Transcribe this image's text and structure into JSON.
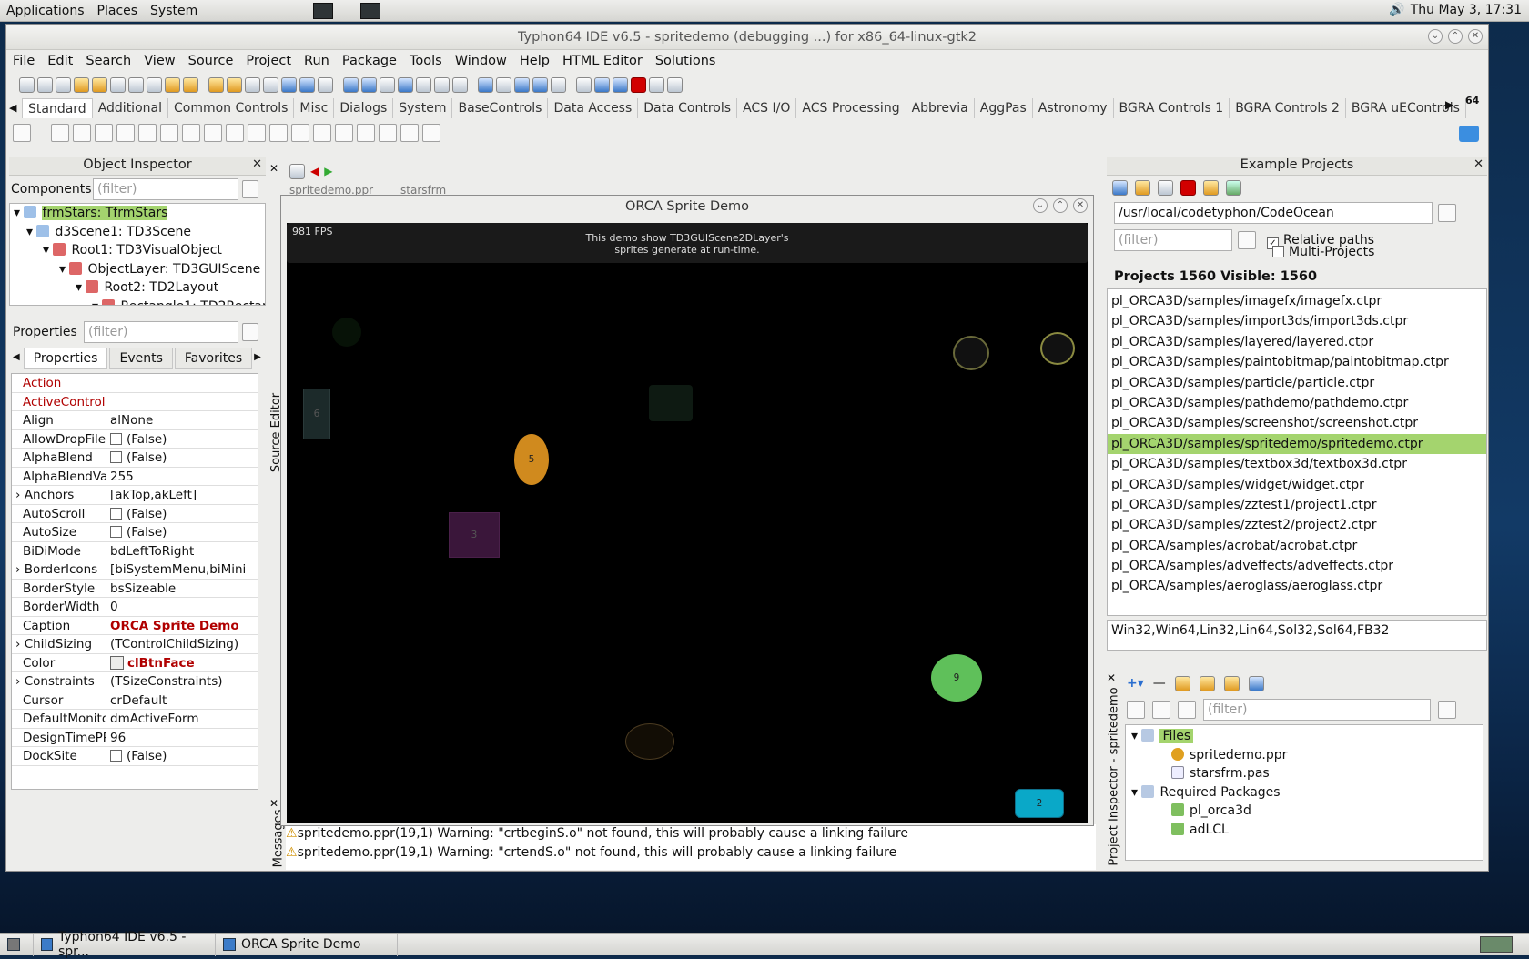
{
  "panel": {
    "menus": [
      "Applications",
      "Places",
      "System"
    ],
    "clock": "Thu May  3, 17:31"
  },
  "ide": {
    "title": "Typhon64 IDE v6.5 - spritedemo (debugging ...) for x86_64-linux-gtk2",
    "menu": [
      "File",
      "Edit",
      "Search",
      "View",
      "Source",
      "Project",
      "Run",
      "Package",
      "Tools",
      "Window",
      "Help",
      "HTML Editor",
      "Solutions"
    ],
    "palette_tabs": [
      "Standard",
      "Additional",
      "Common Controls",
      "Misc",
      "Dialogs",
      "System",
      "BaseControls",
      "Data Access",
      "Data Controls",
      "ACS I/O",
      "ACS Processing",
      "Abbrevia",
      "AggPas",
      "Astronomy",
      "BGRA Controls 1",
      "BGRA Controls 2",
      "BGRA uEControls"
    ],
    "palette_count": "64"
  },
  "object_inspector": {
    "title": "Object Inspector",
    "components_label": "Components",
    "filter_placeholder": "(filter)",
    "tree": [
      "frmStars: TfrmStars",
      "d3Scene1: TD3Scene",
      "Root1: TD3VisualObject",
      "ObjectLayer: TD3GUIScene",
      "Root2: TD2Layout",
      "Rectangle1: TD2Rectan"
    ],
    "properties_label": "Properties",
    "tabs": [
      "Properties",
      "Events",
      "Favorites"
    ],
    "props": [
      {
        "name": "Action",
        "value": ""
      },
      {
        "name": "ActiveControl",
        "value": ""
      },
      {
        "name": "Align",
        "value": "alNone"
      },
      {
        "name": "AllowDropFiles",
        "value": "(False)"
      },
      {
        "name": "AlphaBlend",
        "value": "(False)"
      },
      {
        "name": "AlphaBlendValue",
        "value": "255"
      },
      {
        "name": "Anchors",
        "value": "[akTop,akLeft]"
      },
      {
        "name": "AutoScroll",
        "value": "(False)"
      },
      {
        "name": "AutoSize",
        "value": "(False)"
      },
      {
        "name": "BiDiMode",
        "value": "bdLeftToRight"
      },
      {
        "name": "BorderIcons",
        "value": "[biSystemMenu,biMini"
      },
      {
        "name": "BorderStyle",
        "value": "bsSizeable"
      },
      {
        "name": "BorderWidth",
        "value": "0"
      },
      {
        "name": "Caption",
        "value": "ORCA Sprite Demo"
      },
      {
        "name": "ChildSizing",
        "value": "(TControlChildSizing)"
      },
      {
        "name": "Color",
        "value": "clBtnFace"
      },
      {
        "name": "Constraints",
        "value": "(TSizeConstraints)"
      },
      {
        "name": "Cursor",
        "value": "crDefault"
      },
      {
        "name": "DefaultMonitor",
        "value": "dmActiveForm"
      },
      {
        "name": "DesignTimePPI",
        "value": "96"
      },
      {
        "name": "DockSite",
        "value": "(False)"
      }
    ]
  },
  "source_editor": {
    "label": "Source Editor",
    "tabs": [
      "spritedemo.ppr",
      "starsfrm"
    ]
  },
  "messages": {
    "label": "Messages",
    "lines": [
      "spritedemo.ppr(19,1) Warning: \"crtbeginS.o\" not found, this will probably cause a linking failure",
      "spritedemo.ppr(19,1) Warning: \"crtendS.o\" not found, this will probably cause a linking failure"
    ]
  },
  "orca": {
    "title": "ORCA Sprite Demo",
    "fps": "981 FPS",
    "info": [
      "This demo show TD3GUIScene2DLayer's",
      "sprites generate at run-time."
    ],
    "sprites": [
      "6",
      "5",
      "3",
      "9",
      "2"
    ]
  },
  "example_projects": {
    "title": "Example Projects",
    "path": "/usr/local/codetyphon/CodeOcean",
    "filter_placeholder": "(filter)",
    "relative_paths": "Relative paths",
    "multi_projects": "Multi-Projects",
    "stats": "Projects 1560  Visible: 1560",
    "items": [
      "pl_ORCA3D/samples/imagefx/imagefx.ctpr",
      "pl_ORCA3D/samples/import3ds/import3ds.ctpr",
      "pl_ORCA3D/samples/layered/layered.ctpr",
      "pl_ORCA3D/samples/paintobitmap/paintobitmap.ctpr",
      "pl_ORCA3D/samples/particle/particle.ctpr",
      "pl_ORCA3D/samples/pathdemo/pathdemo.ctpr",
      "pl_ORCA3D/samples/screenshot/screenshot.ctpr",
      "pl_ORCA3D/samples/spritedemo/spritedemo.ctpr",
      "pl_ORCA3D/samples/textbox3d/textbox3d.ctpr",
      "pl_ORCA3D/samples/widget/widget.ctpr",
      "pl_ORCA3D/samples/zztest1/project1.ctpr",
      "pl_ORCA3D/samples/zztest2/project2.ctpr",
      "pl_ORCA/samples/acrobat/acrobat.ctpr",
      "pl_ORCA/samples/adveffects/adveffects.ctpr",
      "pl_ORCA/samples/aeroglass/aeroglass.ctpr"
    ],
    "selected_index": 7,
    "platforms": "Win32,Win64,Lin32,Lin64,Sol32,Sol64,FB32"
  },
  "project_inspector": {
    "label": "Project Inspector - spritedemo",
    "filter_placeholder": "(filter)",
    "files_label": "Files",
    "files": [
      "spritedemo.ppr",
      "starsfrm.pas"
    ],
    "required_label": "Required Packages",
    "packages": [
      "pl_orca3d",
      "adLCL"
    ]
  },
  "taskbar": {
    "items": [
      "Typhon64 IDE v6.5 - spr...",
      "ORCA Sprite Demo"
    ]
  }
}
